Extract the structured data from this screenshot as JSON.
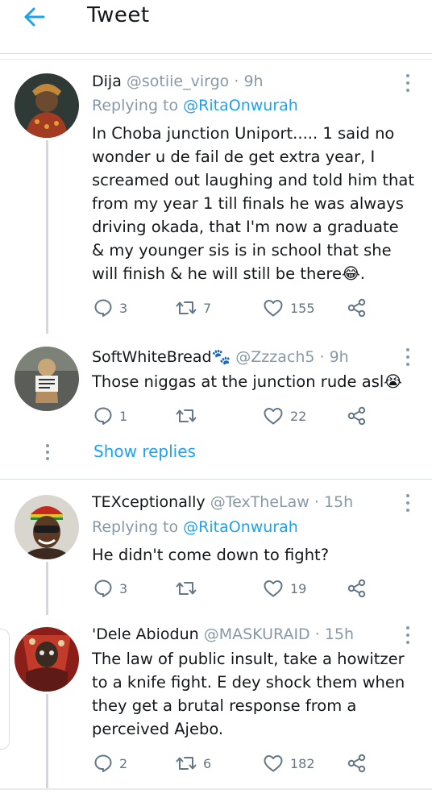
{
  "header": {
    "title": "Tweet",
    "back_icon": "arrow-left-icon",
    "accent": "#1da1f2"
  },
  "tweets": [
    {
      "name": "Dija",
      "handle": "@sotiie_virgo",
      "time": "9h",
      "replying_prefix": "Replying to",
      "replying_handle": "@RitaOnwurah",
      "text": "In Choba junction Uniport..... 1 said no wonder u de fail de get extra year, I screamed out laughing and told him that from my year 1 till finals he was always driving okada, that I'm now a graduate & my younger sis is in school that she will finish & he will still be there😂.",
      "replies": "3",
      "retweets": "7",
      "likes": "155"
    },
    {
      "name": "SoftWhiteBread🐾",
      "handle": "@Zzzach5",
      "time": "9h",
      "text": "Those niggas at the junction rude asl😭",
      "replies": "1",
      "retweets": "",
      "likes": "22"
    },
    {
      "name": "TEXceptionally",
      "handle": "@TexTheLaw",
      "time": "15h",
      "replying_prefix": "Replying to",
      "replying_handle": "@RitaOnwurah",
      "text": "He didn't come down to fight?",
      "replies": "3",
      "retweets": "",
      "likes": "19"
    },
    {
      "name": "'Dele Abiodun",
      "handle": "@MASKURAID",
      "time": "15h",
      "text": "The law of public insult, take a howitzer to a knife fight. E dey shock them when they get a brutal response from a perceived Ajebo.",
      "replies": "2",
      "retweets": "6",
      "likes": "182"
    }
  ],
  "show_replies": "Show replies",
  "icons": [
    "reply-icon",
    "retweet-icon",
    "like-icon",
    "share-icon",
    "more-icon"
  ]
}
